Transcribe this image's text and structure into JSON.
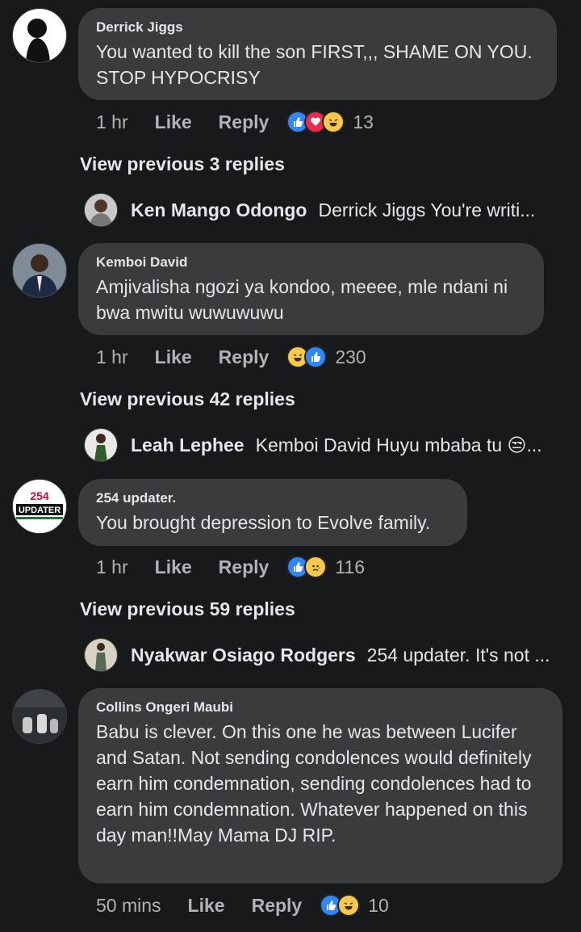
{
  "comments": [
    {
      "author": "Derrick Jiggs",
      "text": "You wanted to kill the son FIRST,,, SHAME ON YOU. STOP HYPOCRISY",
      "time": "1 hr",
      "like_label": "Like",
      "reply_label": "Reply",
      "reaction_icons": [
        "like-icon",
        "love-icon",
        "haha-icon"
      ],
      "reaction_count": "13",
      "view_previous": "View previous 3 replies",
      "latest_reply": {
        "name": "Ken Mango Odongo",
        "text": "Derrick Jiggs  You're writi..."
      }
    },
    {
      "author": "Kemboi David",
      "text": "Amjivalisha ngozi ya kondoo, meeee, mle ndani ni bwa mwitu wuwuwuwu",
      "time": "1 hr",
      "like_label": "Like",
      "reply_label": "Reply",
      "reaction_icons": [
        "haha-icon",
        "like-icon"
      ],
      "reaction_count": "230",
      "view_previous": "View previous 42 replies",
      "latest_reply": {
        "name": "Leah Lephee",
        "text": "Kemboi David Huyu mbaba tu 😒..."
      }
    },
    {
      "author": "254 updater.",
      "text": "You brought depression to Evolve family.",
      "time": "1 hr",
      "like_label": "Like",
      "reply_label": "Reply",
      "reaction_icons": [
        "like-icon",
        "sad-icon"
      ],
      "reaction_count": "116",
      "view_previous": "View previous 59 replies",
      "latest_reply": {
        "name": "Nyakwar Osiago Rodgers",
        "text": "254 updater. It's not ..."
      }
    },
    {
      "author": "Collins Ongeri Maubi",
      "text": "Babu is clever. On this one he was between Lucifer and Satan. Not sending condolences would definitely earn him condemnation, sending condolences had to earn him condemnation. Whatever happened on this day man!!May Mama DJ RIP.",
      "time": "50 mins",
      "like_label": "Like",
      "reply_label": "Reply",
      "reaction_icons": [
        "like-icon",
        "haha-icon"
      ],
      "reaction_count": "10"
    }
  ],
  "avatar_logo_text": "254 UPDATER",
  "colors": {
    "background": "#18191a",
    "bubble": "#3a3b3c",
    "text": "#e4e6eb",
    "muted": "#b0b3b8",
    "like": "#2d88ff",
    "love": "#f0284a",
    "haha": "#f7c948"
  }
}
